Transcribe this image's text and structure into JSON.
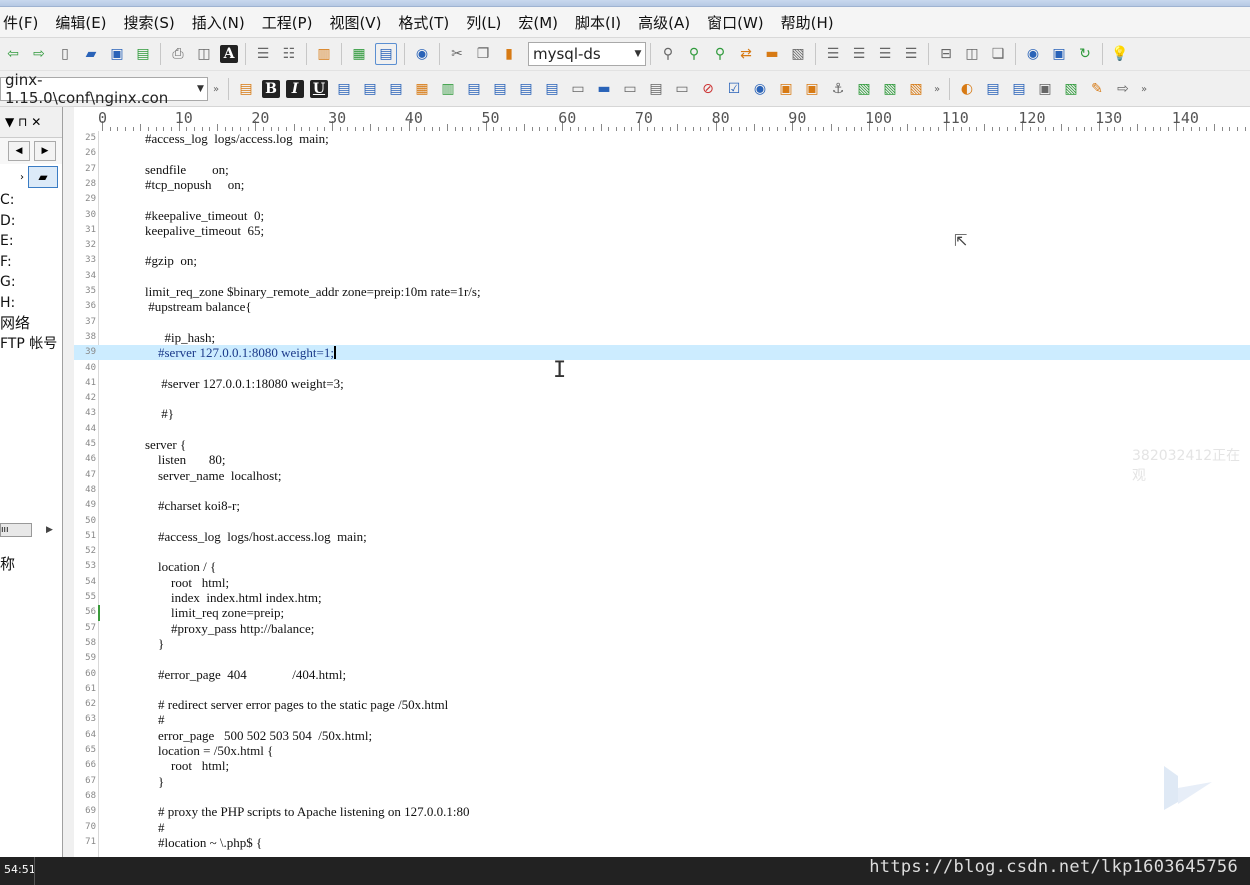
{
  "menu": [
    "件(F)",
    "编辑(E)",
    "搜索(S)",
    "插入(N)",
    "工程(P)",
    "视图(V)",
    "格式(T)",
    "列(L)",
    "宏(M)",
    "脚本(I)",
    "高级(A)",
    "窗口(W)",
    "帮助(H)"
  ],
  "toolbar": {
    "connection_combo": "mysql-ds",
    "path_combo": "ginx-1.15.0\\conf\\nginx.con",
    "bold_label": "B",
    "italic_label": "I",
    "underline_label": "U",
    "font_label": "A"
  },
  "sidebar": {
    "pin_glyph": "▼ ⊓ ✕",
    "drives": [
      "C:",
      "D:",
      "E:",
      "F:",
      "G:",
      "H:",
      "网络",
      "FTP 帐号"
    ],
    "bottom_label": "称"
  },
  "ruler_labels": [
    "0",
    "10",
    "20",
    "30",
    "40",
    "50",
    "60",
    "70",
    "80",
    "90",
    "100",
    "110",
    "120",
    "130",
    "140"
  ],
  "editor": {
    "highlight_line": 39,
    "lines": [
      {
        "num": "25",
        "text": "    #access_log  logs/access.log  main;"
      },
      {
        "num": "26",
        "text": ""
      },
      {
        "num": "27",
        "text": "    sendfile        on;"
      },
      {
        "num": "28",
        "text": "    #tcp_nopush     on;"
      },
      {
        "num": "29",
        "text": ""
      },
      {
        "num": "30",
        "text": "    #keepalive_timeout  0;"
      },
      {
        "num": "31",
        "text": "    keepalive_timeout  65;"
      },
      {
        "num": "32",
        "text": ""
      },
      {
        "num": "33",
        "text": "    #gzip  on;"
      },
      {
        "num": "34",
        "text": ""
      },
      {
        "num": "35",
        "text": "    limit_req_zone $binary_remote_addr zone=preip:10m rate=1r/s;"
      },
      {
        "num": "36",
        "text": "     #upstream balance{"
      },
      {
        "num": "37",
        "text": ""
      },
      {
        "num": "38",
        "text": "          #ip_hash;"
      },
      {
        "num": "39",
        "text": "        #server 127.0.0.1:8080 weight=1;"
      },
      {
        "num": "40",
        "text": ""
      },
      {
        "num": "41",
        "text": "         #server 127.0.0.1:18080 weight=3;"
      },
      {
        "num": "42",
        "text": ""
      },
      {
        "num": "43",
        "text": "         #}"
      },
      {
        "num": "44",
        "text": ""
      },
      {
        "num": "45",
        "text": "    server {"
      },
      {
        "num": "46",
        "text": "        listen       80;"
      },
      {
        "num": "47",
        "text": "        server_name  localhost;"
      },
      {
        "num": "48",
        "text": ""
      },
      {
        "num": "49",
        "text": "        #charset koi8-r;"
      },
      {
        "num": "50",
        "text": ""
      },
      {
        "num": "51",
        "text": "        #access_log  logs/host.access.log  main;"
      },
      {
        "num": "52",
        "text": ""
      },
      {
        "num": "53",
        "text": "        location / {"
      },
      {
        "num": "54",
        "text": "            root   html;"
      },
      {
        "num": "55",
        "text": "            index  index.html index.htm;"
      },
      {
        "num": "56",
        "text": "            limit_req zone=preip;"
      },
      {
        "num": "57",
        "text": "            #proxy_pass http://balance;"
      },
      {
        "num": "58",
        "text": "        }"
      },
      {
        "num": "59",
        "text": ""
      },
      {
        "num": "60",
        "text": "        #error_page  404              /404.html;"
      },
      {
        "num": "61",
        "text": ""
      },
      {
        "num": "62",
        "text": "        # redirect server error pages to the static page /50x.html"
      },
      {
        "num": "63",
        "text": "        #"
      },
      {
        "num": "64",
        "text": "        error_page   500 502 503 504  /50x.html;"
      },
      {
        "num": "65",
        "text": "        location = /50x.html {"
      },
      {
        "num": "66",
        "text": "            root   html;"
      },
      {
        "num": "67",
        "text": "        }"
      },
      {
        "num": "68",
        "text": ""
      },
      {
        "num": "69",
        "text": "        # proxy the PHP scripts to Apache listening on 127.0.0.1:80"
      },
      {
        "num": "70",
        "text": "        #"
      },
      {
        "num": "71",
        "text": "        #location ~ \\.php$ {"
      }
    ]
  },
  "overlay": {
    "side_watermark": "382032412正在观",
    "status_time": "54:51",
    "url_watermark": "https://blog.csdn.net/lkp1603645756"
  },
  "colors": {
    "highlight": "#ccecff",
    "change_marker": "#3a9a3a"
  }
}
